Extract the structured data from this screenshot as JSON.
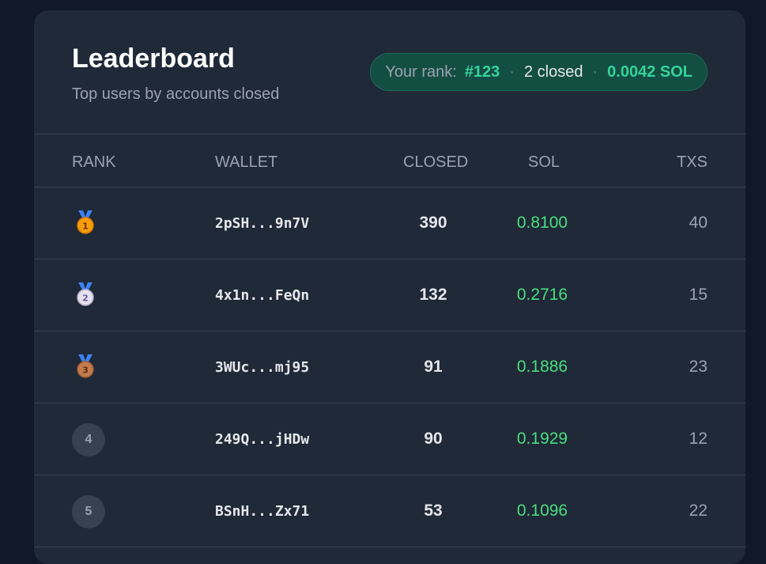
{
  "header": {
    "title": "Leaderboard",
    "subtitle": "Top users by accounts closed"
  },
  "your_rank": {
    "label": "Your rank:",
    "rank": "#123",
    "closed": "2 closed",
    "sol": "0.0042 SOL",
    "separator": "·"
  },
  "columns": {
    "rank": "RANK",
    "wallet": "WALLET",
    "closed": "CLOSED",
    "sol": "SOL",
    "txs": "TXS"
  },
  "rows": [
    {
      "rank": "1",
      "badge": "gold-medal-icon",
      "wallet": "2pSH...9n7V",
      "closed": "390",
      "sol": "0.8100",
      "txs": "40"
    },
    {
      "rank": "2",
      "badge": "silver-medal-icon",
      "wallet": "4x1n...FeQn",
      "closed": "132",
      "sol": "0.2716",
      "txs": "15"
    },
    {
      "rank": "3",
      "badge": "bronze-medal-icon",
      "wallet": "3WUc...mj95",
      "closed": "91",
      "sol": "0.1886",
      "txs": "23"
    },
    {
      "rank": "4",
      "badge": "rank-circle",
      "wallet": "249Q...jHDw",
      "closed": "90",
      "sol": "0.1929",
      "txs": "12"
    },
    {
      "rank": "5",
      "badge": "rank-circle",
      "wallet": "BSnH...Zx71",
      "closed": "53",
      "sol": "0.1096",
      "txs": "22"
    }
  ],
  "colors": {
    "background": "#111827",
    "card": "#1f2937",
    "accent_green": "#34d399",
    "sol_green": "#4ade80",
    "muted": "#9ca3af",
    "gold": "#f59e0b",
    "silver": "#d1d5db",
    "bronze": "#b87333",
    "ribbon": "#3b82f6"
  }
}
